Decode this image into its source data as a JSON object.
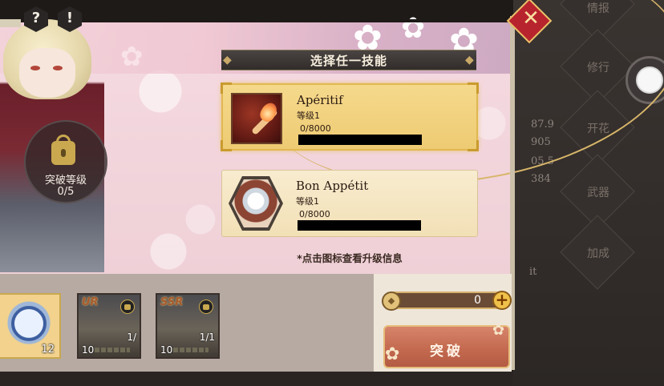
{
  "panel": {
    "title": "选择任一技能",
    "hint": "*点击图标查看升级信息"
  },
  "skills": [
    {
      "name": "Apéritif",
      "level": "等级1",
      "progress": "0/8000",
      "selected": true,
      "icon": "torch-icon"
    },
    {
      "name": "Bon Appétit",
      "level": "等级1",
      "progress": "0/8000",
      "selected": false,
      "icon": "cloche-icon"
    }
  ],
  "breakthrough": {
    "label": "突破等级",
    "value": "0/5"
  },
  "top_icons": {
    "help": "?",
    "info": "!"
  },
  "side_menu": [
    {
      "label": "情报"
    },
    {
      "label": "修行"
    },
    {
      "label": "开花"
    },
    {
      "label": "武器"
    },
    {
      "label": "加成"
    }
  ],
  "side_stats": [
    "87.9",
    "905",
    "05.5",
    "384"
  ],
  "side_misc": "it",
  "materials": [
    {
      "type": "moon-crystal",
      "count": "12"
    },
    {
      "type": "card",
      "rarity": "UR",
      "level": "10",
      "fraction": "1/"
    },
    {
      "type": "card",
      "rarity": "SSR",
      "level": "10",
      "fraction": "1/1"
    }
  ],
  "quantity": {
    "value": "0",
    "plus": "+"
  },
  "breakthrough_button": "突破",
  "colors": {
    "panel_pink": "#f2d5dc",
    "card_gold": "#eecb73",
    "button_coral": "#c2684e",
    "badge_red": "#b8242d"
  }
}
